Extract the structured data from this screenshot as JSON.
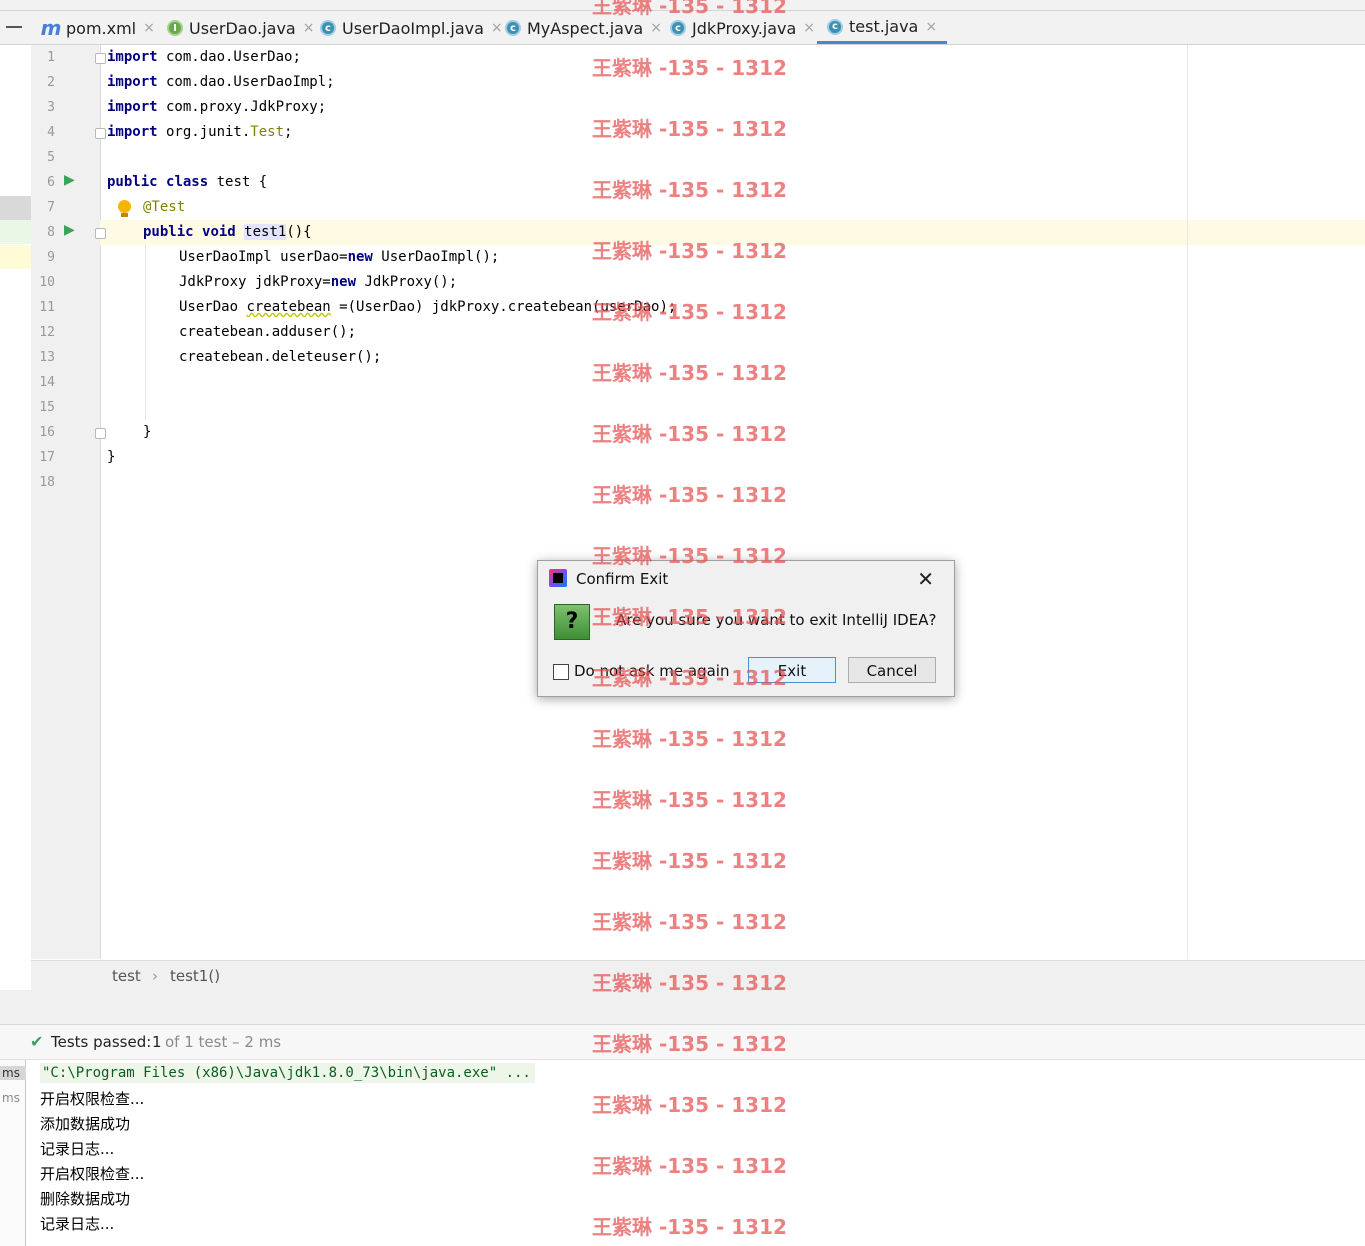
{
  "tabs": [
    {
      "label": "pom.xml",
      "icon": "maven-icon",
      "glyph": "m"
    },
    {
      "label": "UserDao.java",
      "icon": "interface-icon",
      "glyph": "I"
    },
    {
      "label": "UserDaoImpl.java",
      "icon": "class-icon",
      "glyph": "c"
    },
    {
      "label": "MyAspect.java",
      "icon": "class-icon",
      "glyph": "c"
    },
    {
      "label": "JdkProxy.java",
      "icon": "class-icon",
      "glyph": "c"
    },
    {
      "label": "test.java",
      "icon": "test-class-icon",
      "glyph": "c"
    }
  ],
  "tab_close_glyph": "×",
  "editor": {
    "line_numbers": [
      "1",
      "2",
      "3",
      "4",
      "5",
      "6",
      "7",
      "8",
      "9",
      "10",
      "11",
      "12",
      "13",
      "14",
      "15",
      "16",
      "17",
      "18"
    ],
    "kw": {
      "import": "import",
      "public": "public",
      "class": "class",
      "void": "void",
      "new": "new"
    },
    "code": {
      "l1": " com.dao.UserDao;",
      "l2": " com.dao.UserDaoImpl;",
      "l3": " com.proxy.JdkProxy;",
      "l4a": " org.junit.",
      "l4b": "Test",
      "l4c": ";",
      "l6": " test {",
      "l7": "@Test",
      "l8a": "test1",
      "l8b": "(){",
      "l9a": "UserDaoImpl userDao=",
      "l9b": " UserDaoImpl();",
      "l10a": "JdkProxy jdkProxy=",
      "l10b": " JdkProxy();",
      "l11a": "UserDao ",
      "l11b": "createbean",
      "l11c": " =(UserDao) jdkProxy.createbean(userDao);",
      "l12": "createbean.adduser();",
      "l13": "createbean.deleteuser();",
      "l16": "}",
      "l17": "}"
    }
  },
  "breadcrumb": {
    "items": [
      "test",
      "test1()"
    ],
    "separator": "›"
  },
  "tests": {
    "check": "✔",
    "label": "Tests passed:",
    "count": "1",
    "detail": "of 1 test – 2 ms"
  },
  "console": {
    "ms_labels": [
      "ms",
      "ms"
    ],
    "command": "\"C:\\Program Files (x86)\\Java\\jdk1.8.0_73\\bin\\java.exe\" ...",
    "lines": [
      "开启权限检查...",
      "添加数据成功",
      "记录日志...",
      "开启权限检查...",
      "删除数据成功",
      "记录日志..."
    ]
  },
  "dialog": {
    "title": "Confirm Exit",
    "message": "Are you sure you want to exit IntelliJ IDEA?",
    "question_glyph": "?",
    "checkbox_label": "Do not ask me again",
    "exit_label": "Exit",
    "cancel_label": "Cancel",
    "close_glyph": "✕"
  },
  "watermark": "王紫琳 -135 - 1312",
  "colors": {
    "accent": "#4a86c8",
    "keyword": "#000080",
    "annotation": "#808000",
    "watermark": "#e65050",
    "tests_passed": "#3aa35a"
  }
}
